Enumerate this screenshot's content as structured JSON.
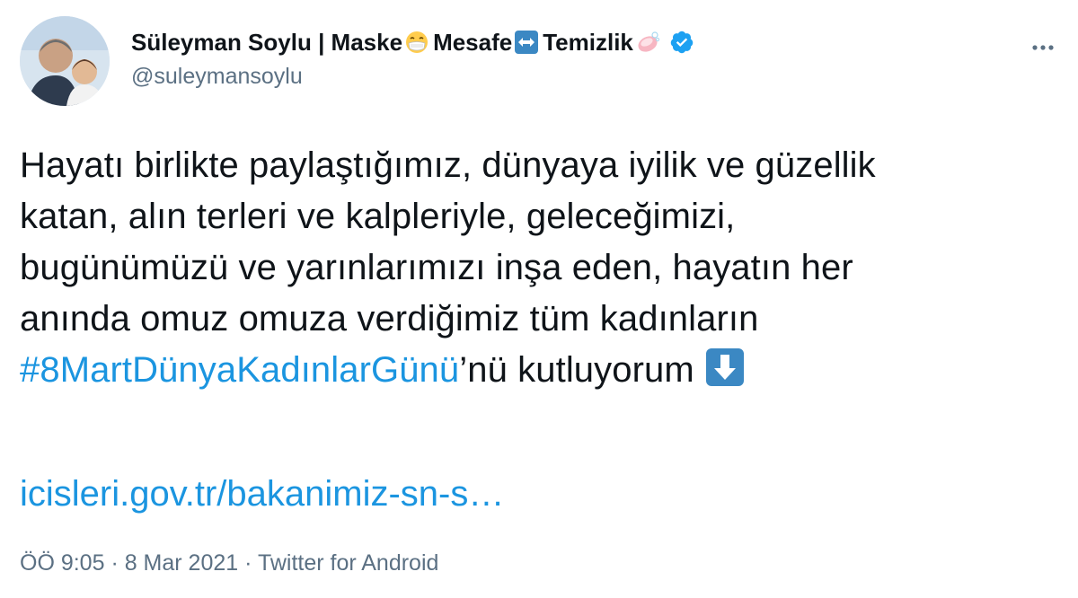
{
  "user": {
    "name_part1": "Süleyman Soylu | Maske",
    "name_part2": "Mesafe",
    "name_part3": "Temizlik",
    "name_emojis": [
      "face-with-medical-mask-icon",
      "left-right-arrow-icon",
      "soap-icon"
    ],
    "handle": "@suleymansoylu",
    "verified": true
  },
  "tweet": {
    "lines": [
      "Hayatı birlikte paylaştığımız, dünyaya iyilik ve güzellik",
      "katan, alın terleri ve kalpleriyle, geleceğimizi,",
      "bugünümüzü ve yarınlarımızı inşa eden, hayatın her",
      "anında omuz omuza verdiğimiz tüm kadınların"
    ],
    "hashtag": "#8MartDünyaKadınlarGünü",
    "hashtag_suffix": "’nü kutluyorum",
    "link": "icisleri.gov.tr/bakanimiz-sn-s…"
  },
  "meta": {
    "text": "ÖÖ 9:05 · 8 Mar 2021 · Twitter for Android"
  },
  "colors": {
    "link": "#1b95e0",
    "secondary_text": "#5b7083",
    "verified": "#1da1f2",
    "emoji_arrow_bg": "#3b88c3"
  }
}
